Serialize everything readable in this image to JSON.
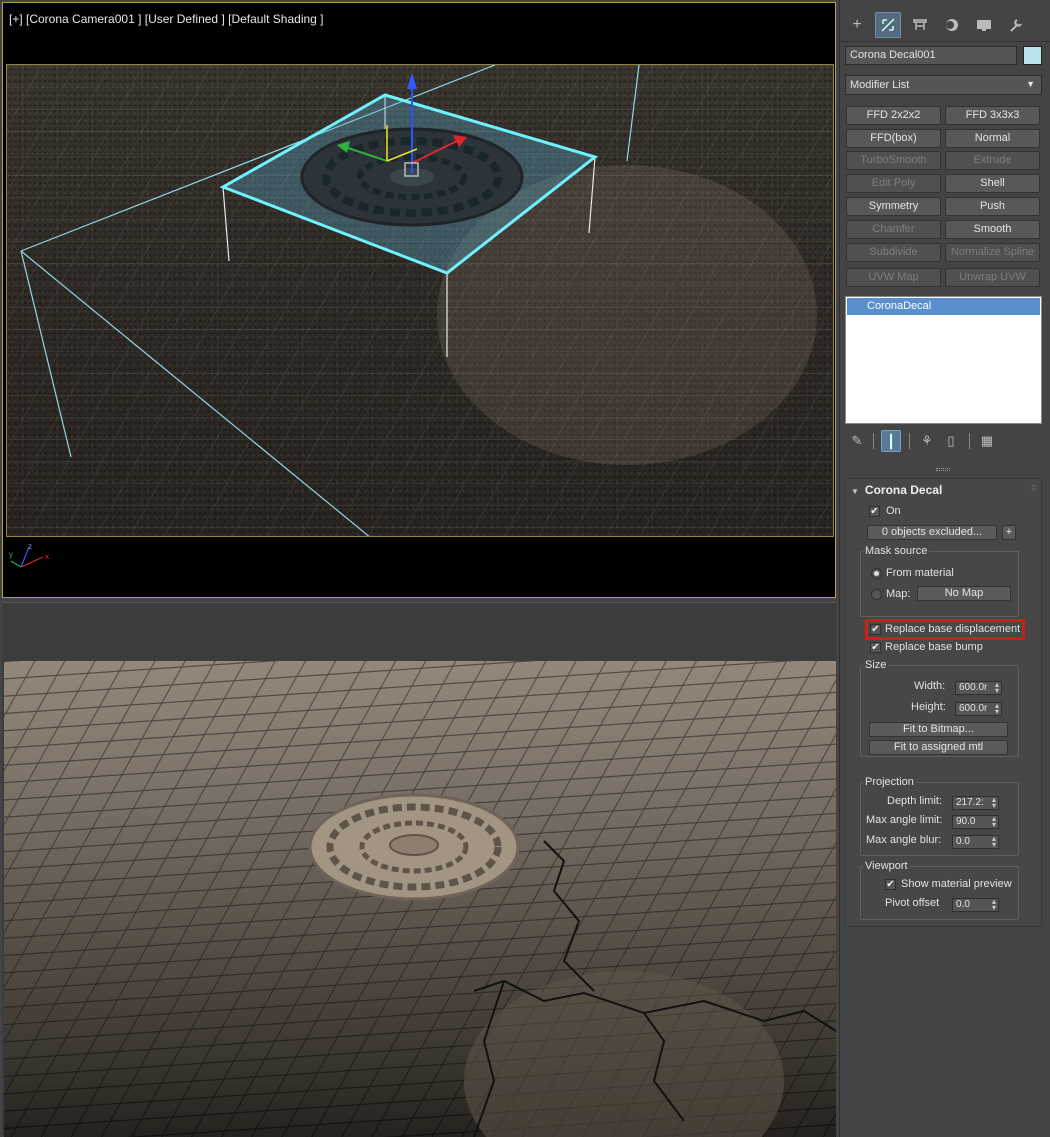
{
  "viewport": {
    "label": "[+] [Corona Camera001 ] [User Defined ] [Default Shading ]",
    "axis": {
      "x": "x",
      "y": "y",
      "z": "z"
    },
    "gizmo_z": "z"
  },
  "panel": {
    "tabs": [
      {
        "name": "create",
        "icon": "plus-icon"
      },
      {
        "name": "modify",
        "icon": "modify-icon"
      },
      {
        "name": "hierarchy",
        "icon": "hierarchy-icon"
      },
      {
        "name": "motion",
        "icon": "motion-icon"
      },
      {
        "name": "display",
        "icon": "display-icon"
      },
      {
        "name": "utilities",
        "icon": "wrench-icon"
      }
    ],
    "object_name": "Corona Decal001",
    "object_color": "#b9e4ef",
    "modifier_list": "Modifier List",
    "modifier_buttons": [
      {
        "label": "FFD 2x2x2",
        "enabled": true
      },
      {
        "label": "FFD 3x3x3",
        "enabled": true
      },
      {
        "label": "FFD(box)",
        "enabled": true
      },
      {
        "label": "Normal",
        "enabled": true
      },
      {
        "label": "TurboSmooth",
        "enabled": false
      },
      {
        "label": "Extrude",
        "enabled": false
      },
      {
        "label": "Edit Poly",
        "enabled": false
      },
      {
        "label": "Shell",
        "enabled": true
      },
      {
        "label": "Symmetry",
        "enabled": true
      },
      {
        "label": "Push",
        "enabled": true
      },
      {
        "label": "Chamfer",
        "enabled": false
      },
      {
        "label": "Smooth",
        "enabled": true
      },
      {
        "label": "Subdivide",
        "enabled": false
      },
      {
        "label": "Normalize Spline",
        "enabled": false
      },
      {
        "label": "UVW Map",
        "enabled": false
      },
      {
        "label": "Unwrap UVW",
        "enabled": false
      }
    ],
    "stack_item": "CoronaDecal"
  },
  "rollout": {
    "title": "Corona Decal",
    "on_label": "On",
    "on_checked": true,
    "excluded_button": "0 objects excluded...",
    "add_button": "+",
    "mask_source": {
      "title": "Mask source",
      "from_material": "From material",
      "map_label": "Map:",
      "map_button": "No Map",
      "selected": "from_material"
    },
    "replace_displacement": "Replace base displacement",
    "replace_bump": "Replace base bump",
    "size": {
      "title": "Size",
      "width_label": "Width:",
      "width_value": "600.0r",
      "height_label": "Height:",
      "height_value": "600.0r",
      "fit_bitmap": "Fit to Bitmap...",
      "fit_mtl": "Fit to assigned mtl"
    },
    "projection": {
      "title": "Projection",
      "depth_label": "Depth limit:",
      "depth_value": "217.2:",
      "max_angle_label": "Max angle limit:",
      "max_angle_value": "90.0",
      "angle_blur_label": "Max angle blur:",
      "angle_blur_value": "0.0"
    },
    "viewport": {
      "title": "Viewport",
      "show_preview": "Show material preview",
      "pivot_label": "Pivot offset",
      "pivot_value": "0.0"
    },
    "highlight_color": "#d21b1b"
  }
}
